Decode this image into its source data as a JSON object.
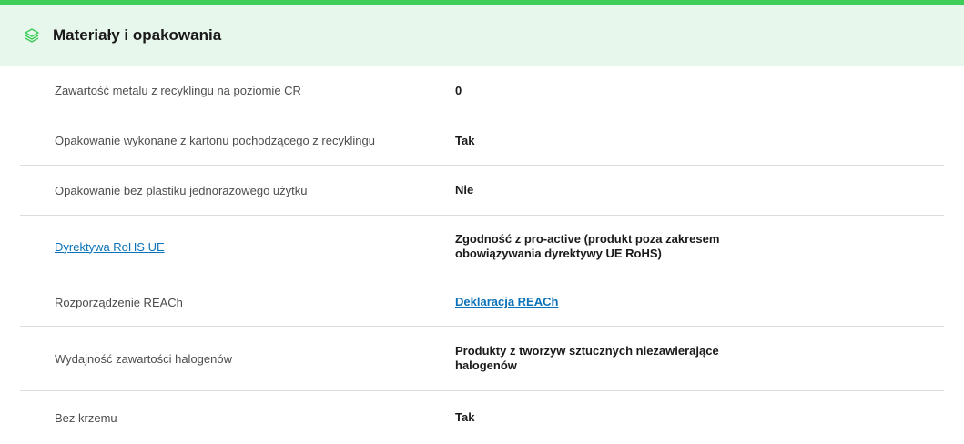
{
  "section": {
    "icon": "layers-icon",
    "title": "Materiały i opakowania"
  },
  "rows": [
    {
      "label": "Zawartość metalu z recyklingu na poziomie CR",
      "value": "0"
    },
    {
      "label": "Opakowanie wykonane z kartonu pochodzącego z recyklingu",
      "value": "Tak"
    },
    {
      "label": "Opakowanie bez plastiku jednorazowego użytku",
      "value": "Nie"
    },
    {
      "label": "Dyrektywa RoHS UE",
      "value": "Zgodność z pro-active (produkt poza zakresem obowiązywania dyrektywy UE RoHS)"
    },
    {
      "label": "Rozporządzenie REACh",
      "value": "Deklaracja REACh"
    },
    {
      "label": "Wydajność zawartości halogenów",
      "value": "Produkty z tworzyw sztucznych niezawierające halogenów"
    },
    {
      "label": "Bez krzemu",
      "value": "Tak"
    }
  ],
  "colors": {
    "accent": "#3dcd58",
    "header_bg": "#e8f7ec",
    "link": "#0a72b8"
  }
}
